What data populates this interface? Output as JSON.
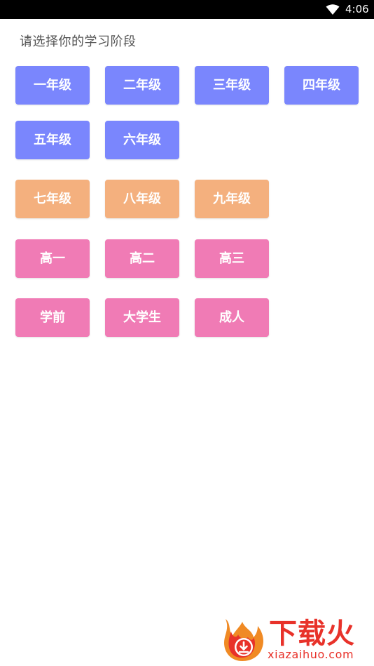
{
  "status_bar": {
    "time": "4:06",
    "wifi_icon": "wifi-icon"
  },
  "prompt": "请选择你的学习阶段",
  "colors": {
    "primary": "#7a86fd",
    "middle": "#f4b07e",
    "senior": "#f07bb5",
    "logo": "#e8322a"
  },
  "grades": {
    "primary": [
      "一年级",
      "二年级",
      "三年级",
      "四年级",
      "五年级",
      "六年级"
    ],
    "middle": [
      "七年级",
      "八年级",
      "九年级"
    ],
    "senior": [
      "高一",
      "高二",
      "高三"
    ],
    "other": [
      "学前",
      "大学生",
      "成人"
    ]
  },
  "watermark": {
    "brand": "下载火",
    "domain": "xiazaihuo.com"
  }
}
